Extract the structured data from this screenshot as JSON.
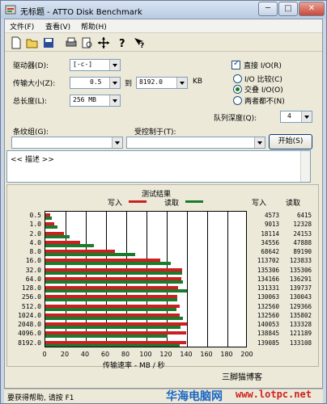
{
  "window": {
    "title": "无标题 - ATTO Disk Benchmark",
    "minimize": "─",
    "maximize": "□",
    "close": "✕"
  },
  "menu": [
    "文件(F)",
    "查看(V)",
    "帮助(H)"
  ],
  "toolbar_icons": [
    "new-file-icon",
    "open-folder-icon",
    "save-icon",
    "print-icon",
    "print-preview-icon",
    "move-icon",
    "help-icon",
    "context-help-icon"
  ],
  "form": {
    "drive_label": "驱动器(D):",
    "drive_value": "[-c-]",
    "transfer_label": "传输大小(Z):",
    "transfer_from": "0.5",
    "to_label": "到",
    "transfer_to": "8192.0",
    "kb_label": "KB",
    "total_label": "总长度(L):",
    "total_value": "256 MB",
    "direct_io_label": "直接 I/O(R)",
    "direct_io_checked": true,
    "io_compare_label": "I/O 比较(C)",
    "overlap_io_label": "交叠 I/O(O)",
    "neither_label": "两者都不(N)",
    "selected_io": "overlap",
    "queue_label": "队列深度(Q):",
    "queue_value": "4",
    "stripe_label": "条纹组(G):",
    "controlled_label": "受控制于(T):",
    "start_button": "开始(S)",
    "description": "<< 描述 >>"
  },
  "chart_data": {
    "type": "bar",
    "title": "测试结果",
    "legend": [
      {
        "name": "写入",
        "color": "#cc1f1f"
      },
      {
        "name": "读取",
        "color": "#1a7a2e"
      }
    ],
    "xlabel": "传输速率 - MB / 秒",
    "xlim": [
      0,
      200
    ],
    "xticks": [
      "0",
      "20",
      "40",
      "60",
      "80",
      "100",
      "120",
      "140",
      "160",
      "180",
      "200"
    ],
    "categories": [
      "0.5",
      "1.0",
      "2.0",
      "4.0",
      "8.0",
      "16.0",
      "32.0",
      "64.0",
      "128.0",
      "256.0",
      "512.0",
      "1024.0",
      "2048.0",
      "4096.0",
      "8192.0"
    ],
    "write_header": "写入",
    "read_header": "读取",
    "series": [
      {
        "name": "写入",
        "values": [
          4573,
          9013,
          18114,
          34556,
          68642,
          113702,
          135306,
          134166,
          131331,
          130063,
          132560,
          132560,
          140053,
          138845,
          139085
        ]
      },
      {
        "name": "读取",
        "values": [
          6415,
          12328,
          24153,
          47888,
          89190,
          123833,
          135306,
          136291,
          139737,
          130043,
          129366,
          135802,
          133328,
          121189,
          133108
        ]
      }
    ],
    "write_text": [
      "4573",
      "9013",
      "18114",
      "34556",
      "68642",
      "113702",
      "135306",
      "134166",
      "131331",
      "130063",
      "132560",
      "132560",
      "140053",
      "138845",
      "139085"
    ],
    "read_text": [
      "6415",
      "12328",
      "24153",
      "47888",
      "89190",
      "123833",
      "135306",
      "136291",
      "139737",
      "130043",
      "129366",
      "135802",
      "133328",
      "121189",
      "133108"
    ]
  },
  "watermark_top": "三脚猫博客",
  "status_text": "要获得帮助, 请按 F1",
  "watermark_bottom": "华海电脑网",
  "watermark_url": "www.lotpc.net"
}
